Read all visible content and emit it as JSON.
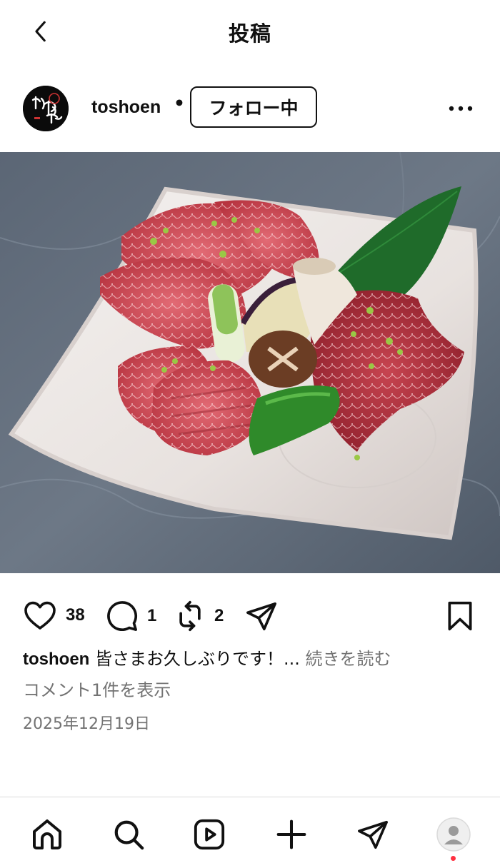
{
  "header": {
    "title": "投稿"
  },
  "author": {
    "username": "toshoen",
    "separator": "•",
    "follow_label": "フォロー中",
    "avatar_text": "桃松苑"
  },
  "post": {
    "image_alt": "",
    "likes": "38",
    "comments": "1",
    "reposts": "2",
    "caption_user": "toshoen",
    "caption_text": "皆さまお久しぶりです！...",
    "read_more": "続きを読む",
    "view_comments": "コメント1件を表示",
    "date": "2025年12月19日"
  },
  "icons": {
    "back": "chevron-left-icon",
    "more": "more-horizontal-icon",
    "like": "heart-icon",
    "comment": "comment-icon",
    "repost": "repost-icon",
    "share": "paper-plane-icon",
    "save": "bookmark-icon",
    "nav": [
      "home-icon",
      "search-icon",
      "reels-icon",
      "plus-icon",
      "send-icon",
      "profile-icon"
    ]
  },
  "colors": {
    "text": "#111111",
    "secondary": "#737373",
    "divider": "#dbdbdb",
    "notification": "#ff3040"
  }
}
